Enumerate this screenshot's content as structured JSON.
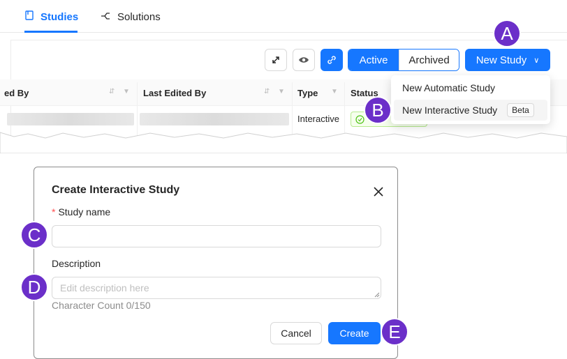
{
  "tabs": [
    {
      "label": "Studies"
    },
    {
      "label": "Solutions"
    }
  ],
  "toolbar": {
    "segment_active": "Active",
    "segment_archived": "Archived",
    "new_study": "New Study"
  },
  "table": {
    "headers": [
      "ed By",
      "Last Edited By",
      "Type",
      "Status"
    ],
    "row_type": "Interactive"
  },
  "dropdown": {
    "items": [
      {
        "label": "New Automatic Study"
      },
      {
        "label": "New Interactive Study",
        "badge": "Beta"
      }
    ]
  },
  "modal": {
    "title": "Create Interactive Study",
    "name_label": "Study name",
    "required_mark": "*",
    "name_value": "",
    "desc_label": "Description",
    "desc_placeholder": "Edit description here",
    "char_count": "Character Count 0/150",
    "cancel": "Cancel",
    "create": "Create"
  },
  "annotations": [
    "A",
    "B",
    "C",
    "D",
    "E"
  ],
  "colors": {
    "accent": "#1677ff",
    "annotation": "#6b2fc9"
  }
}
